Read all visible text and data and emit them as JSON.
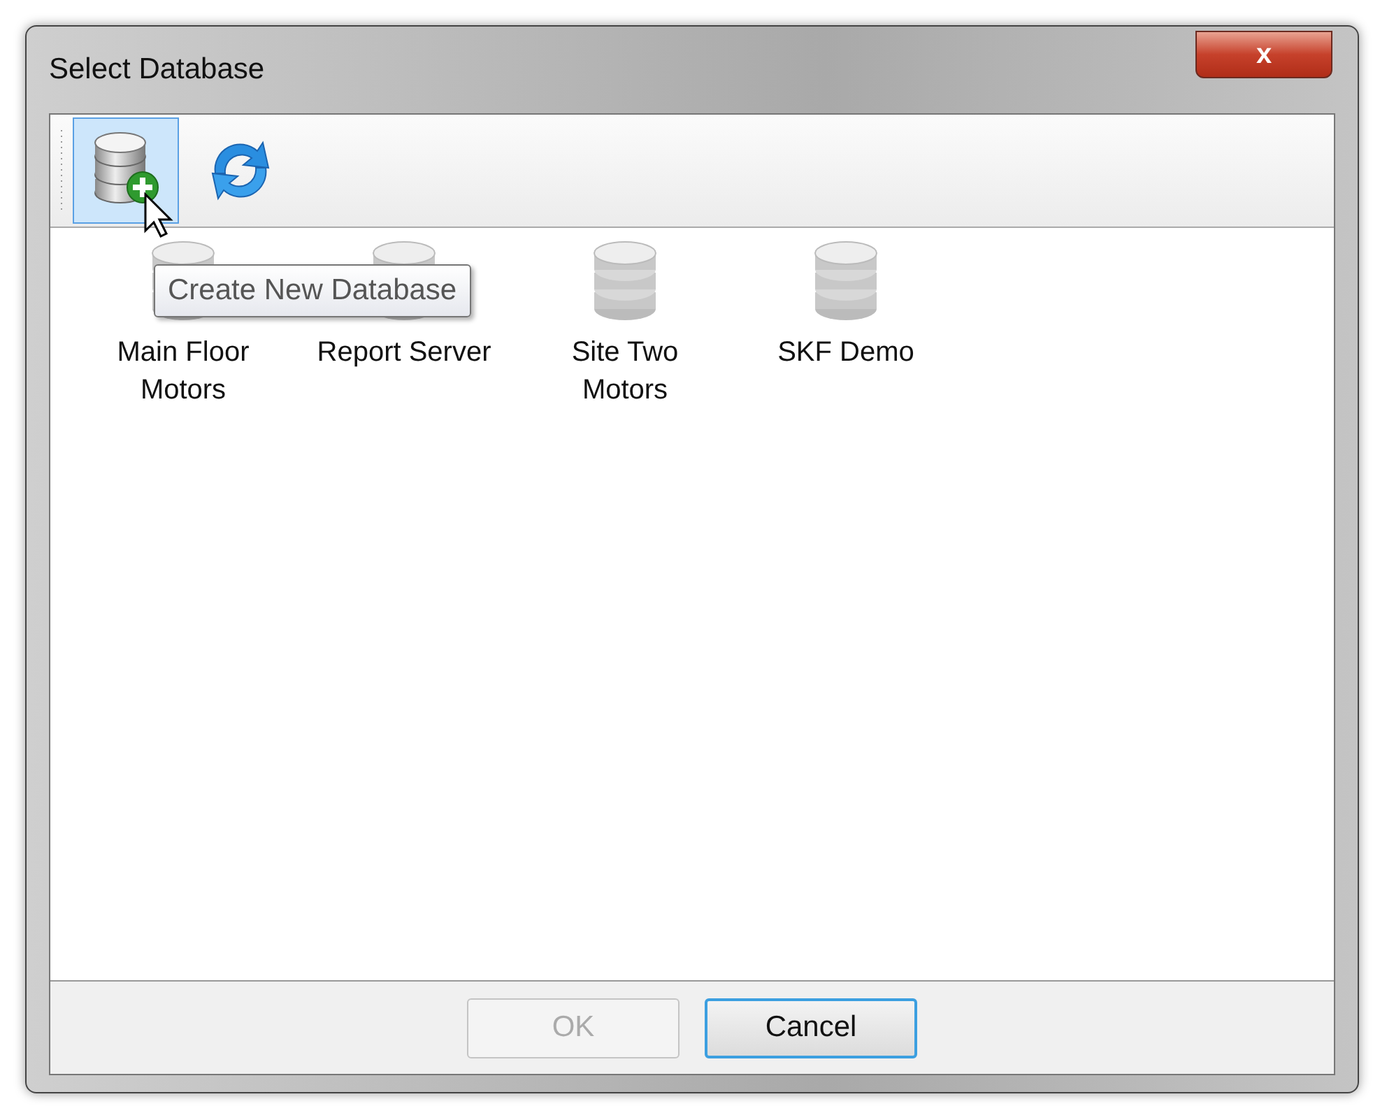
{
  "window": {
    "title": "Select Database",
    "close_label": "x"
  },
  "toolbar": [
    {
      "kind": "add-database",
      "highlighted": true
    },
    {
      "kind": "refresh",
      "highlighted": false
    }
  ],
  "tooltip": "Create New Database",
  "databases": [
    {
      "name": "Main Floor Motors",
      "selected": false
    },
    {
      "name": "Report Server",
      "selected": false
    },
    {
      "name": "Site Two Motors",
      "selected": false
    },
    {
      "name": "SKF Demo",
      "selected": false
    }
  ],
  "buttons": [
    {
      "label": "OK",
      "disabled": true,
      "default": false
    },
    {
      "label": "Cancel",
      "disabled": false,
      "default": true
    }
  ]
}
